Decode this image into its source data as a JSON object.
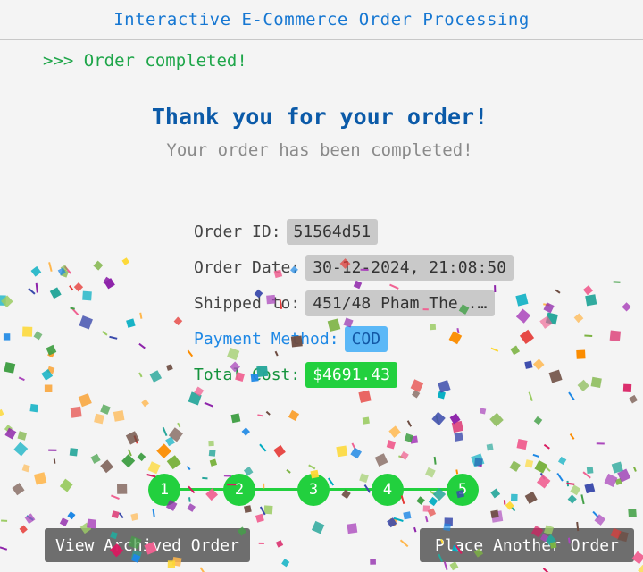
{
  "app": {
    "title": "Interactive E-Commerce Order Processing"
  },
  "status": {
    "text": ">>> Order completed!"
  },
  "thanks": {
    "heading": "Thank you for your order!",
    "subheading": "Your order has been completed!"
  },
  "order": {
    "id_label": "Order ID:",
    "id_value": "51564d51",
    "date_label": "Order Date:",
    "date_value": "30-12-2024, 21:08:50",
    "ship_label": "Shipped to:",
    "ship_value": "451/48 Pham The ...",
    "payment_label": "Payment Method:",
    "payment_value": "COD",
    "total_label": "Total Cost:",
    "total_value": "$4691.43"
  },
  "steps": [
    "1",
    "2",
    "3",
    "4",
    "5"
  ],
  "buttons": {
    "archived": "View Archived Order",
    "another": "Place Another Order"
  },
  "colors": {
    "accent": "#1677d2",
    "success": "#22d03e",
    "status_text": "#1fa64a",
    "button_bg": "#6e6e6e"
  }
}
